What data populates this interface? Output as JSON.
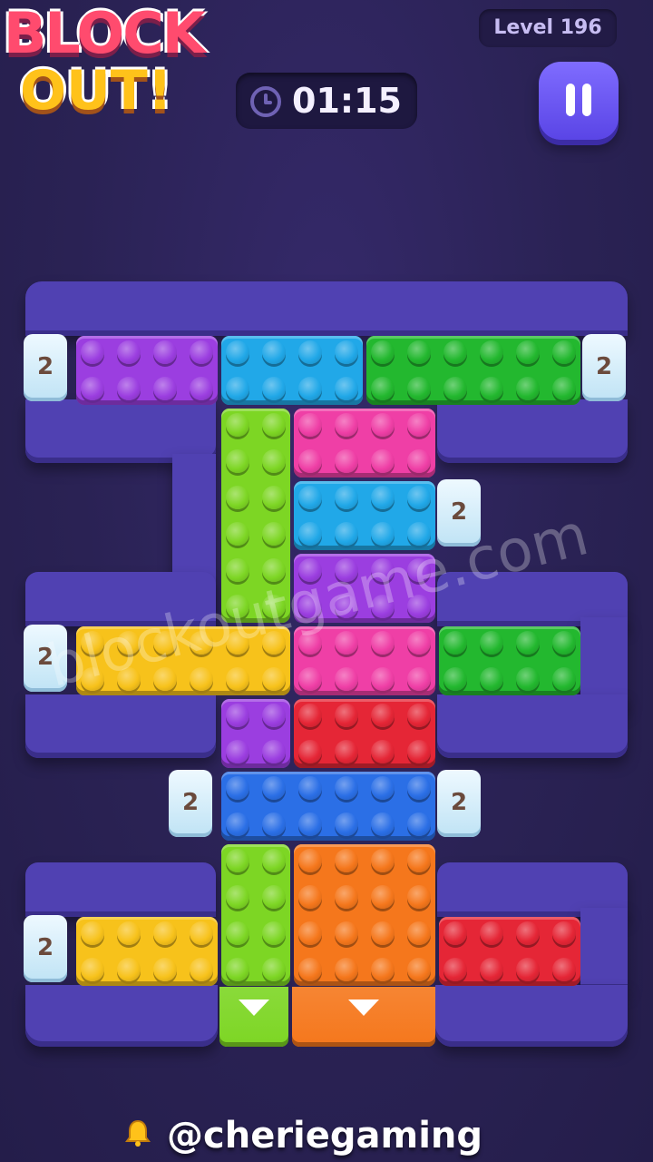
{
  "header": {
    "logo_line1": "BLOCK",
    "logo_line2": "OUT!",
    "level_label": "Level 196",
    "timer": "01:15",
    "clock_icon": "clock-icon",
    "pause_icon": "pause-icon"
  },
  "colors": {
    "purple": "#9b3ee0",
    "cyan": "#21a8e8",
    "green": "#23b82f",
    "lime": "#7dd624",
    "pink": "#ef3fa6",
    "yellow": "#f7c21b",
    "red": "#e52636",
    "blue": "#2b6fe6",
    "orange": "#f5771c",
    "track": "#5041b2",
    "background": "#2c2456"
  },
  "gates": [
    {
      "label": "2"
    },
    {
      "label": "2"
    },
    {
      "label": "2"
    },
    {
      "label": "2"
    },
    {
      "label": "2"
    },
    {
      "label": "2"
    },
    {
      "label": "2"
    }
  ],
  "blocks": [
    {
      "color": "purple",
      "cols": 4,
      "rows": 2
    },
    {
      "color": "cyan",
      "cols": 4,
      "rows": 2
    },
    {
      "color": "green",
      "cols": 6,
      "rows": 2
    },
    {
      "color": "lime",
      "cols": 2,
      "rows": 6
    },
    {
      "color": "pink",
      "cols": 4,
      "rows": 2
    },
    {
      "color": "cyan",
      "cols": 4,
      "rows": 2
    },
    {
      "color": "purple",
      "cols": 4,
      "rows": 2
    },
    {
      "color": "yellow",
      "cols": 6,
      "rows": 2
    },
    {
      "color": "pink",
      "cols": 4,
      "rows": 2
    },
    {
      "color": "green",
      "cols": 4,
      "rows": 2
    },
    {
      "color": "purple",
      "cols": 2,
      "rows": 2
    },
    {
      "color": "red",
      "cols": 4,
      "rows": 2
    },
    {
      "color": "blue",
      "cols": 6,
      "rows": 2
    },
    {
      "color": "lime",
      "cols": 2,
      "rows": 4
    },
    {
      "color": "orange",
      "cols": 4,
      "rows": 4
    },
    {
      "color": "yellow",
      "cols": 4,
      "rows": 2
    },
    {
      "color": "red",
      "cols": 4,
      "rows": 2
    }
  ],
  "exits": [
    {
      "color": "lime",
      "icon": "arrow-down-icon"
    },
    {
      "color": "orange",
      "icon": "arrow-down-icon"
    }
  ],
  "watermark": "blockoutgame.com",
  "footer": {
    "handle": "@cheriegaming",
    "icon": "bell-icon"
  }
}
